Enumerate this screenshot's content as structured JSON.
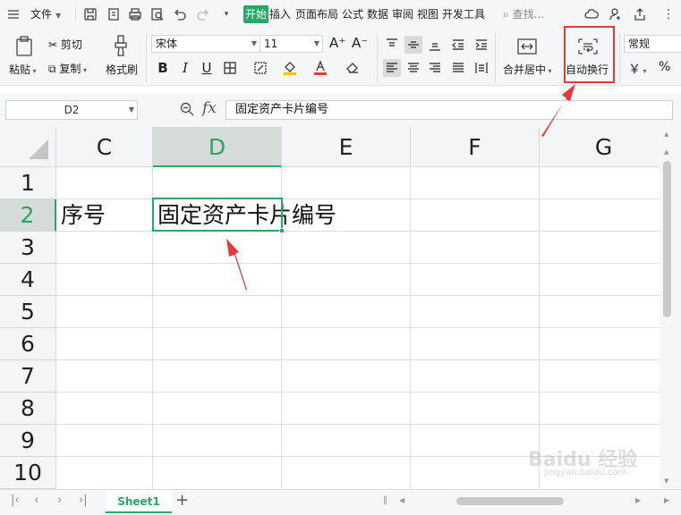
{
  "menubar": {
    "file_label": "文件",
    "tabs": [
      "开始",
      "插入",
      "页面布局",
      "公式",
      "数据",
      "审阅",
      "视图",
      "开发工具"
    ],
    "search_label": "查找..."
  },
  "ribbon": {
    "paste_label": "粘贴",
    "cut_label": "剪切",
    "copy_label": "复制",
    "format_painter_label": "格式刷",
    "font_name": "宋体",
    "font_size": "11",
    "increase_font": "A⁺",
    "decrease_font": "A⁻",
    "bold": "B",
    "italic": "I",
    "underline": "U",
    "merge_label": "合并居中",
    "wrap_label": "自动换行",
    "number_format": "常规",
    "currency_symbol": "￥",
    "percent_symbol": "%"
  },
  "formula_bar": {
    "cell_ref": "D2",
    "fx_label": "fx",
    "content": "固定资产卡片编号"
  },
  "grid": {
    "columns": [
      "C",
      "D",
      "E",
      "F",
      "G"
    ],
    "rows": [
      "1",
      "2",
      "3",
      "4",
      "5",
      "6",
      "7",
      "8",
      "9",
      "10"
    ],
    "cells": {
      "C2": "序号",
      "D2": "固定资产卡片编号"
    }
  },
  "sheets": {
    "tabs": [
      "Sheet1"
    ],
    "add_label": "+"
  },
  "watermark": {
    "text": "Baidu 经验",
    "sub": "jingyan.baidu.com"
  },
  "colors": {
    "accent": "#2aa667",
    "annotation": "#e23b3b"
  }
}
